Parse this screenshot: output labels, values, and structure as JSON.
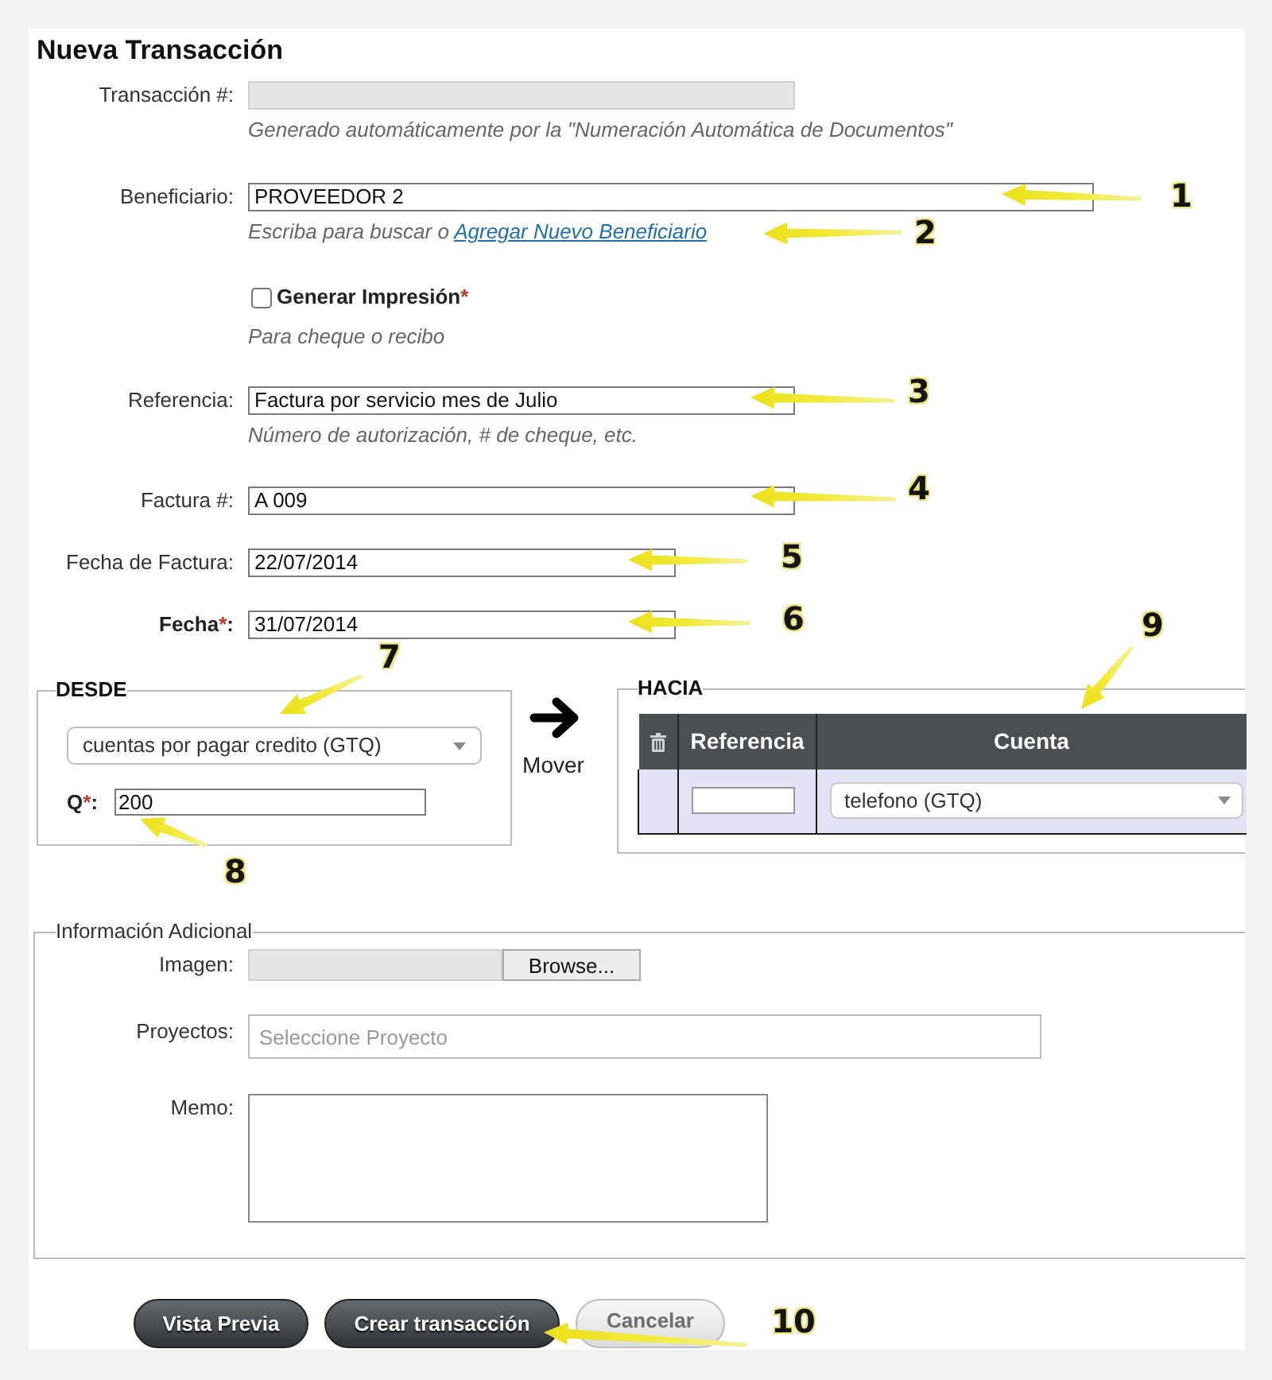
{
  "title": "Nueva Transacción",
  "fields": [
    {
      "kind": "text",
      "label": "Transacción #:",
      "disabled": true,
      "help": "Generado automáticamente por la \"Numeración Automática de Documentos\""
    },
    {
      "kind": "text",
      "label": "Beneficiario:",
      "value": "PROVEEDOR 2",
      "disabled": false,
      "help": "Escriba para buscar o",
      "help_link": "Agregar Nuevo Beneficiario"
    },
    {
      "kind": "checkbox",
      "label": "Generar Impresión",
      "asterisk": "*",
      "checked": false,
      "help": "Para cheque o recibo"
    },
    {
      "kind": "text",
      "label": "Referencia:",
      "value": "Factura por servicio mes de Julio",
      "disabled": false,
      "help": "Número de autorización, # de cheque, etc."
    },
    {
      "kind": "text",
      "label": "Factura #:",
      "value": "A 009",
      "disabled": false
    },
    {
      "kind": "text",
      "label": "Fecha de Factura:",
      "value": "22/07/2014",
      "disabled": false
    },
    {
      "kind": "text",
      "label": "Fecha",
      "asterisk": "*",
      "colon": ":",
      "value": "31/07/2014",
      "disabled": false
    }
  ],
  "transfer": {
    "from": {
      "legend": "DESDE",
      "account": "cuentas por pagar credito (GTQ)",
      "amount_label": "Q",
      "amount_asterisk": "*",
      "amount_colon": ":",
      "amount": "200"
    },
    "move_label": "Mover",
    "to": {
      "legend": "HACIA",
      "columns": [
        "Referencia",
        "Cuenta"
      ],
      "rows": [
        {
          "account": "telefono (GTQ)"
        }
      ]
    }
  },
  "additional": {
    "legend": "Información Adicional",
    "image_label": "Imagen:",
    "browse_button": "Browse...",
    "projects_label": "Proyectos:",
    "projects_placeholder": "Seleccione Proyecto",
    "memo_label": "Memo:"
  },
  "buttons": [
    {
      "label": "Vista Previa",
      "disabled": false
    },
    {
      "label": "Crear transacción",
      "disabled": false
    },
    {
      "label": "Cancelar",
      "disabled": true
    }
  ],
  "callouts": [
    {
      "number": "1"
    },
    {
      "number": "2"
    },
    {
      "number": "3"
    },
    {
      "number": "4"
    },
    {
      "number": "5"
    },
    {
      "number": "6"
    },
    {
      "number": "7"
    },
    {
      "number": "8"
    },
    {
      "number": "9"
    },
    {
      "number": "10"
    }
  ]
}
